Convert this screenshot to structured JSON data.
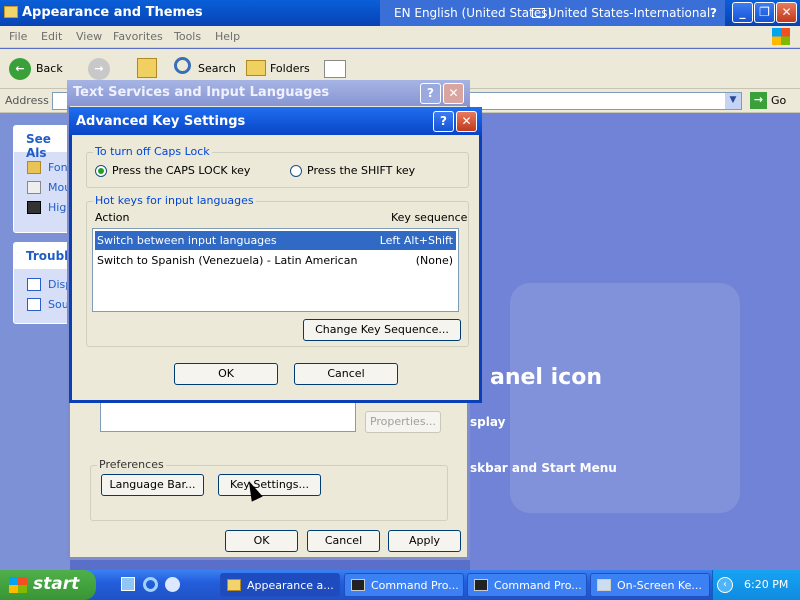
{
  "explorer": {
    "title": "Appearance and Themes",
    "language_indicator": "EN English (United States)",
    "keyboard_layout": "United States-International",
    "menu": [
      "File",
      "Edit",
      "View",
      "Favorites",
      "Tools",
      "Help"
    ],
    "toolbar": {
      "back": "Back",
      "search": "Search",
      "folders": "Folders"
    },
    "address_label": "Address",
    "go_label": "Go",
    "see_also": {
      "title": "See Als",
      "items": [
        "Fon",
        "Mou",
        "High"
      ]
    },
    "troubleshooters": {
      "title": "Trouble",
      "items": [
        "Disp",
        "Sou"
      ]
    },
    "main_heading_fragment": "anel icon",
    "main_links": [
      "splay",
      "skbar and Start Menu"
    ]
  },
  "text_services": {
    "title": "Text Services and Input Languages",
    "help": "?",
    "close": "✕",
    "properties_button": "Properties...",
    "preferences_label": "Preferences",
    "language_bar_button": "Language Bar...",
    "key_settings_button": "Key Settings...",
    "ok": "OK",
    "cancel": "Cancel",
    "apply": "Apply"
  },
  "advanced": {
    "title": "Advanced Key Settings",
    "caps_group": "To turn off Caps Lock",
    "caps_option1": "Press the CAPS LOCK key",
    "caps_option2": "Press the SHIFT key",
    "hotkeys_group": "Hot keys for input languages",
    "col_action": "Action",
    "col_sequence": "Key sequence",
    "rows": [
      {
        "action": "Switch between input languages",
        "sequence": "Left Alt+Shift"
      },
      {
        "action": "Switch to Spanish (Venezuela) - Latin American",
        "sequence": "(None)"
      }
    ],
    "change_button": "Change Key Sequence...",
    "ok": "OK",
    "cancel": "Cancel"
  },
  "taskbar": {
    "start": "start",
    "tasks": [
      "Appearance a...",
      "Command Pro...",
      "Command Pro...",
      "On-Screen Ke..."
    ],
    "clock": "6:20 PM"
  },
  "colors": {
    "title_active": "#0a44c7",
    "selection": "#316ac5",
    "start": "#389536"
  }
}
